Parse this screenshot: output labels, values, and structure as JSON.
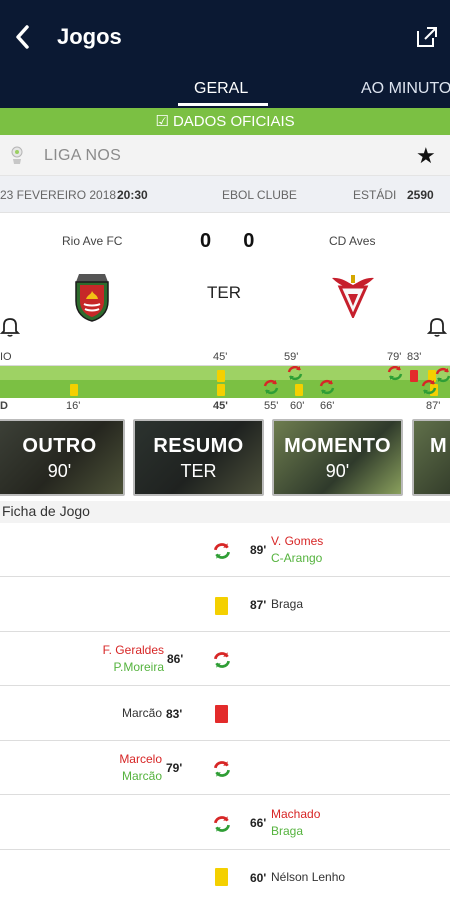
{
  "header": {
    "back_icon": "chevron-left-icon",
    "title": "Jogos",
    "share_icon": "open-external-icon",
    "tabs": [
      {
        "label": "GERAL",
        "active": true
      },
      {
        "label": "AO MINUTO",
        "active": false
      }
    ]
  },
  "official": {
    "label": "☑ DADOS OFICIAIS"
  },
  "league": {
    "name": "LIGA NOS",
    "favorite_icon": "star-icon"
  },
  "match_info": {
    "date": "23 FEVEREIRO 2018",
    "time": "20:30",
    "venue_fragment": "EBOL CLUBE",
    "stadium_label": "ESTÁDI",
    "attendance": "2590"
  },
  "match": {
    "home_team": "Rio Ave FC",
    "away_team": "CD Aves",
    "home_score": "0",
    "away_score": "0",
    "status": "TER",
    "home_bell_icon": "bell-icon",
    "away_bell_icon": "bell-icon"
  },
  "timeline": {
    "top_left": "IO",
    "top_minutes": [
      "45'",
      "59'",
      "79'",
      "83'"
    ],
    "bottom_left": "D",
    "bottom_minutes": [
      "16'",
      "45'",
      "55'",
      "60'",
      "66'",
      "87'"
    ]
  },
  "media_cards": [
    {
      "title": "OUTRO",
      "subtitle": "90'"
    },
    {
      "title": "RESUMO",
      "subtitle": "TER"
    },
    {
      "title": "MOMENTO",
      "subtitle": "90'"
    },
    {
      "title": "M",
      "subtitle": ""
    }
  ],
  "ficha": {
    "label": "Ficha de Jogo"
  },
  "events": [
    {
      "minute": "89'",
      "player_in": "V. Gomes",
      "player_out": "C-Arango",
      "icon": "substitution-icon"
    },
    {
      "minute": "87'",
      "player": "Braga",
      "icon": "yellow-card-icon"
    },
    {
      "minute": "86'",
      "player_in": "F. Geraldes",
      "player_out": "P.Moreira",
      "icon": "substitution-icon"
    },
    {
      "minute": "83'",
      "player": "Marcão",
      "icon": "red-card-icon"
    },
    {
      "minute": "79'",
      "player_in": "Marcelo",
      "player_out": "Marcão",
      "icon": "substitution-icon"
    },
    {
      "minute": "66'",
      "player_in": "Machado",
      "player_out": "Braga",
      "icon": "substitution-icon"
    },
    {
      "minute": "60'",
      "player": "Nélson Lenho",
      "icon": "yellow-card-icon"
    }
  ],
  "colors": {
    "header": "#0b1933",
    "accent_green": "#7bc043",
    "substitution_in": "#d72626",
    "substitution_out": "#55b33e",
    "yellow_card": "#f4d000",
    "red_card": "#e32b2b"
  }
}
